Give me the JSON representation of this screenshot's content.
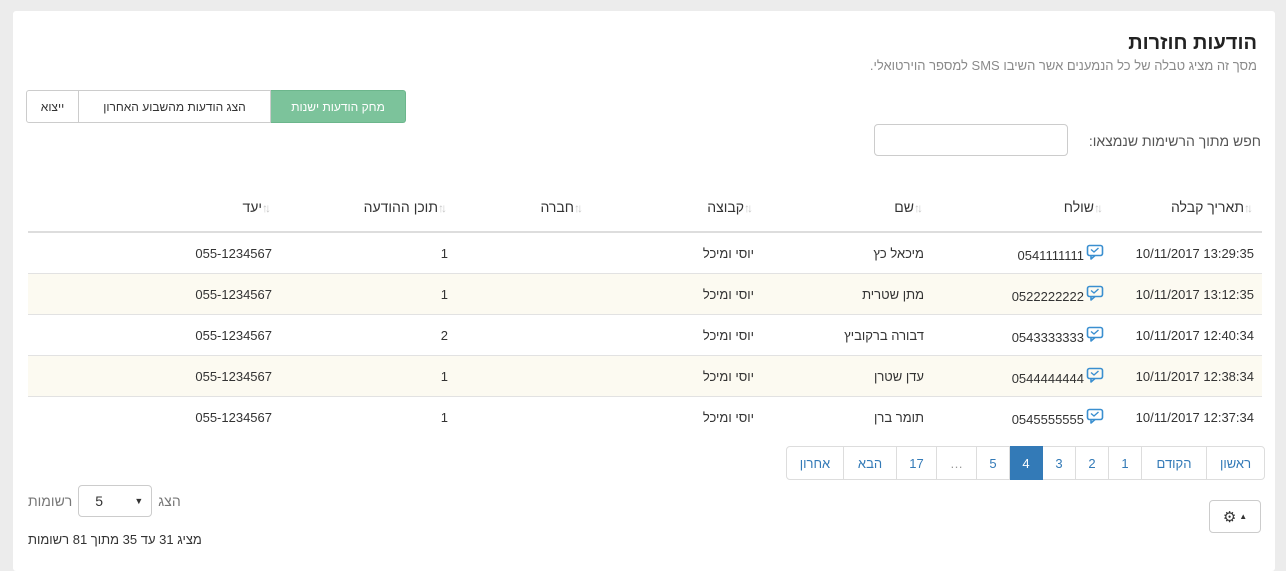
{
  "page": {
    "title": "הודעות חוזרות",
    "subtitle": "מסך זה מציג טבלה של כל הנמענים אשר השיבו SMS למספר הוירטואלי."
  },
  "toolbar": {
    "export_label": "ייצוא",
    "last_week_label": "הצג הודעות מהשבוע האחרון",
    "delete_old_label": "מחק הודעות ישנות",
    "delete_color": "#7cc39b"
  },
  "search": {
    "label": "חפש מתוך הרשימות שנמצאו:",
    "value": ""
  },
  "table": {
    "headers": {
      "date": "תאריך קבלה",
      "sender": "שולח",
      "name": "שם",
      "group": "קבוצה",
      "company": "חברה",
      "content": "תוכן ההודעה",
      "target": "יעד"
    },
    "rows": [
      {
        "date": "10/11/2017 13:29:35",
        "sender": "0541111111",
        "name": "מיכאל כץ",
        "group": "יוסי ומיכל",
        "company": "",
        "content": "1",
        "target": "055-1234567"
      },
      {
        "date": "10/11/2017 13:12:35",
        "sender": "0522222222",
        "name": "מתן שטרית",
        "group": "יוסי ומיכל",
        "company": "",
        "content": "1",
        "target": "055-1234567"
      },
      {
        "date": "10/11/2017 12:40:34",
        "sender": "0543333333",
        "name": "דבורה ברקוביץ",
        "group": "יוסי ומיכל",
        "company": "",
        "content": "2",
        "target": "055-1234567"
      },
      {
        "date": "10/11/2017 12:38:34",
        "sender": "0544444444",
        "name": "עדן שטרן",
        "group": "יוסי ומיכל",
        "company": "",
        "content": "1",
        "target": "055-1234567"
      },
      {
        "date": "10/11/2017 12:37:34",
        "sender": "0545555555",
        "name": "תומר ברן",
        "group": "יוסי ומיכל",
        "company": "",
        "content": "1",
        "target": "055-1234567"
      }
    ]
  },
  "pagination": {
    "first": "ראשון",
    "prev": "הקודם",
    "pages": [
      "1",
      "2",
      "3",
      "4",
      "5",
      "…",
      "17"
    ],
    "active": "4",
    "next": "הבא",
    "last": "אחרון",
    "active_color": "#337ab7"
  },
  "page_size": {
    "show_label": "הצג",
    "value": "5",
    "records_label": "רשומות"
  },
  "summary": "מציג 31 עד 35 מתוך 81 רשומות",
  "icons": {
    "sender": "sms-reply-icon",
    "settings": "gear-icon",
    "sort": "sort-icon"
  }
}
